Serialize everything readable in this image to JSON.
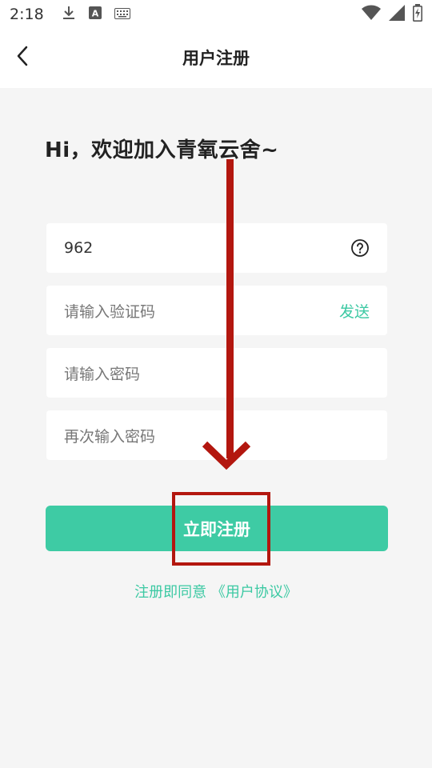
{
  "status_bar": {
    "time": "2:18",
    "icons_left": [
      "download-icon",
      "a-keyboard-icon",
      "keyboard-icon"
    ],
    "icons_right": [
      "wifi-icon",
      "signal-icon",
      "battery-charging-icon"
    ]
  },
  "app_bar": {
    "title": "用户注册",
    "back_icon": "chevron-left-icon"
  },
  "greeting": "Hi，欢迎加入青氧云舍~",
  "form": {
    "phone_value": "962",
    "code_placeholder": "请输入验证码",
    "send_label": "发送",
    "password_placeholder": "请输入密码",
    "confirm_password_placeholder": "再次输入密码"
  },
  "submit_label": "立即注册",
  "agreement": {
    "prefix": "注册即同意 ",
    "link": "《用户协议》"
  },
  "colors": {
    "accent": "#3ecba4",
    "annotation_red": "#b3170f",
    "background": "#f5f5f5"
  }
}
